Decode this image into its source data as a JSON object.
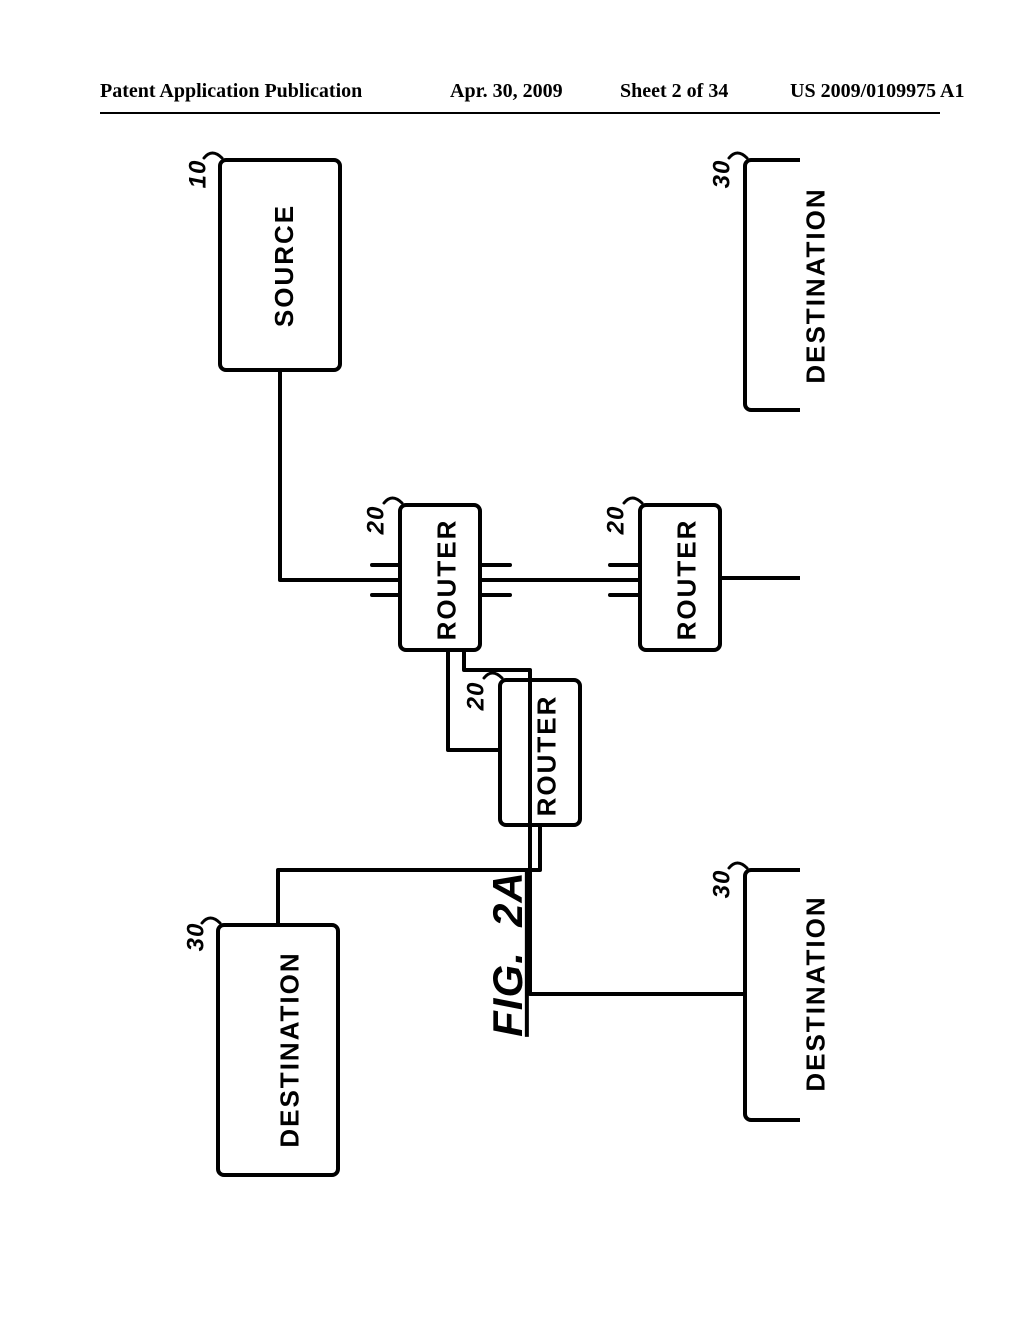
{
  "header": {
    "publication_label": "Patent Application Publication",
    "date": "Apr. 30, 2009",
    "sheet": "Sheet 2 of 34",
    "publication_number": "US 2009/0109975 A1"
  },
  "figure": {
    "caption": "FIG._2A",
    "nodes": {
      "source": {
        "label": "SOURCE",
        "ref": "10"
      },
      "router_a": {
        "label": "ROUTER",
        "ref": "20"
      },
      "router_b": {
        "label": "ROUTER",
        "ref": "20"
      },
      "router_c": {
        "label": "ROUTER",
        "ref": "20"
      },
      "dest_top": {
        "label": "DESTINATION",
        "ref": "30"
      },
      "dest_left": {
        "label": "DESTINATION",
        "ref": "30"
      },
      "dest_right": {
        "label": "DESTINATION",
        "ref": "30"
      }
    }
  }
}
